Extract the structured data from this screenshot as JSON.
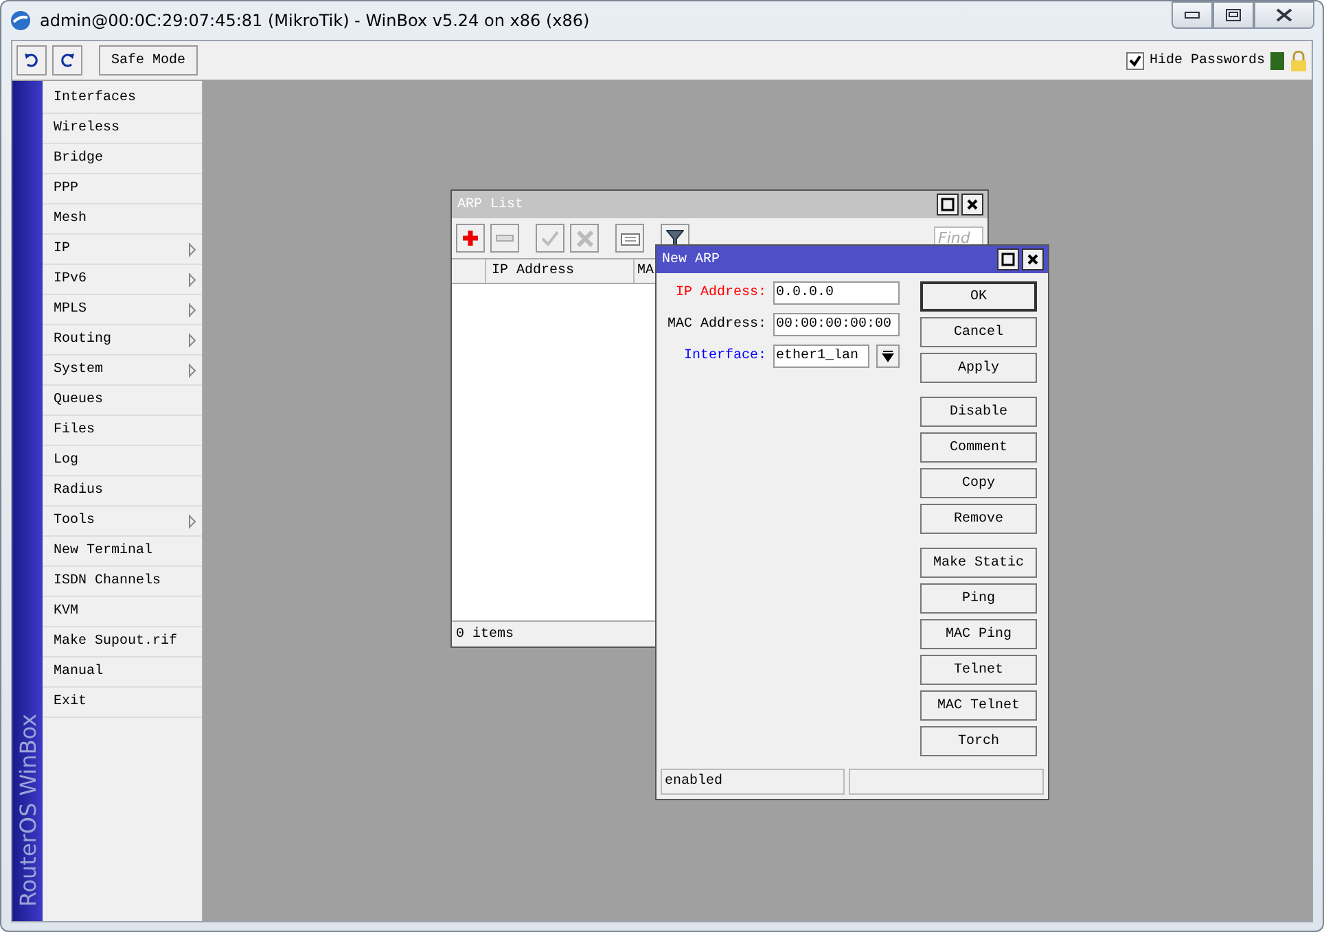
{
  "window": {
    "title": "admin@00:0C:29:07:45:81 (MikroTik) - WinBox v5.24 on x86 (x86)"
  },
  "toolbar": {
    "safe_mode": "Safe Mode",
    "hide_passwords": {
      "label": "Hide Passwords",
      "checked": true
    }
  },
  "sidebar": {
    "brand": "RouterOS WinBox",
    "items": [
      {
        "label": "Interfaces",
        "submenu": false
      },
      {
        "label": "Wireless",
        "submenu": false
      },
      {
        "label": "Bridge",
        "submenu": false
      },
      {
        "label": "PPP",
        "submenu": false
      },
      {
        "label": "Mesh",
        "submenu": false
      },
      {
        "label": "IP",
        "submenu": true
      },
      {
        "label": "IPv6",
        "submenu": true
      },
      {
        "label": "MPLS",
        "submenu": true
      },
      {
        "label": "Routing",
        "submenu": true
      },
      {
        "label": "System",
        "submenu": true
      },
      {
        "label": "Queues",
        "submenu": false
      },
      {
        "label": "Files",
        "submenu": false
      },
      {
        "label": "Log",
        "submenu": false
      },
      {
        "label": "Radius",
        "submenu": false
      },
      {
        "label": "Tools",
        "submenu": true
      },
      {
        "label": "New Terminal",
        "submenu": false
      },
      {
        "label": "ISDN Channels",
        "submenu": false
      },
      {
        "label": "KVM",
        "submenu": false
      },
      {
        "label": "Make Supout.rif",
        "submenu": false
      },
      {
        "label": "Manual",
        "submenu": false
      },
      {
        "label": "Exit",
        "submenu": false
      }
    ]
  },
  "arp_list": {
    "title": "ARP List",
    "find": {
      "placeholder": "Find"
    },
    "columns": [
      "IP Address",
      "MA"
    ],
    "status": "0 items"
  },
  "new_arp": {
    "title": "New ARP",
    "fields": [
      {
        "label": "IP Address:",
        "value": "0.0.0.0",
        "kind": "text",
        "color": "#ff0000"
      },
      {
        "label": "MAC Address:",
        "value": "00:00:00:00:00",
        "kind": "text",
        "color": "#000000"
      },
      {
        "label": "Interface:",
        "value": "ether1_lan",
        "kind": "dropdown",
        "color": "#0000ff"
      }
    ],
    "button_groups": [
      [
        "OK",
        "Cancel",
        "Apply"
      ],
      [
        "Disable",
        "Comment",
        "Copy",
        "Remove"
      ],
      [
        "Make Static",
        "Ping",
        "MAC Ping",
        "Telnet",
        "MAC Telnet",
        "Torch"
      ]
    ],
    "status": "enabled"
  }
}
